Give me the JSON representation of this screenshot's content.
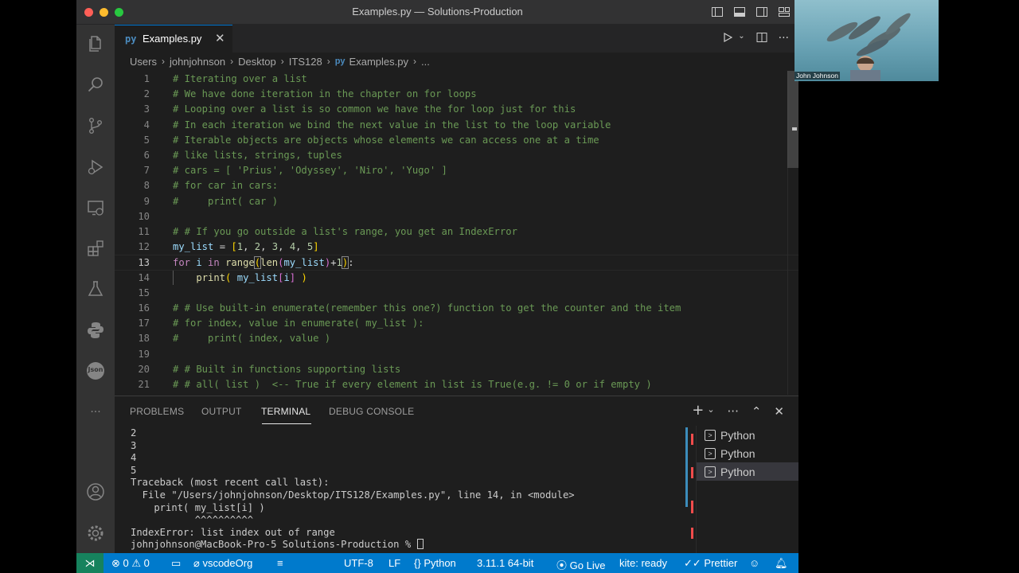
{
  "window": {
    "title": "Examples.py — Solutions-Production"
  },
  "colors": {
    "accent": "#007acc",
    "remote": "#16825d",
    "comment": "#6a9955",
    "keyword": "#c586c0",
    "variable": "#9cdcfe",
    "function": "#dcdcaa",
    "number": "#b5cea8"
  },
  "activity_bar": {
    "items": [
      "files-icon",
      "search-icon",
      "source-control-icon",
      "run-debug-icon",
      "remote-explorer-icon",
      "extensions-icon",
      "testing-icon",
      "python-icon",
      "json-icon",
      "more-icon"
    ],
    "json_label": "Json",
    "bottom": [
      "account-icon",
      "settings-gear-icon"
    ],
    "more": "···"
  },
  "tab": {
    "label": "Examples.py",
    "close": "✕",
    "py_glyph": "py"
  },
  "breadcrumb": [
    "Users",
    "johnjohnson",
    "Desktop",
    "ITS128",
    "Examples.py",
    "..."
  ],
  "editor": {
    "line_numbers": [
      "1",
      "2",
      "3",
      "4",
      "5",
      "6",
      "7",
      "8",
      "9",
      "10",
      "11",
      "12",
      "13",
      "14",
      "15",
      "16",
      "17",
      "18",
      "19",
      "20",
      "21"
    ],
    "comments": {
      "l1": "# Iterating over a list",
      "l2": "# We have done iteration in the chapter on for loops",
      "l3": "# Looping over a list is so common we have the for loop just for this",
      "l4": "# In each iteration we bind the next value in the list to the loop variable",
      "l5": "# Iterable objects are objects whose elements we can access one at a time",
      "l6": "# like lists, strings, tuples",
      "l7": "# cars = [ 'Prius', 'Odyssey', 'Niro', 'Yugo' ]",
      "l8": "# for car in cars:",
      "l9": "#     print( car )",
      "l11": "# # If you go outside a list's range, you get an IndexError",
      "l16": "# # Use built-in enumerate(remember this one?) function to get the counter and the item",
      "l17": "# for index, value in enumerate( my_list ):",
      "l18": "#     print( index, value )",
      "l20": "# # Built in functions supporting lists",
      "l21": "# # all( list )  <-- True if every element in list is True(e.g. != 0 or if empty )"
    },
    "code": {
      "my_list": "my_list",
      "eq": " = ",
      "lb": "[",
      "n1": "1",
      "n2": "2",
      "n3": "3",
      "n4": "4",
      "n5": "5",
      "comma": ", ",
      "rb": "]",
      "for": "for",
      "i": "i",
      "in": "in",
      "range": "range",
      "len": "len",
      "lp": "(",
      "rp": ")",
      "plus": "+",
      "colon": ":",
      "print": "print",
      "sp": " ",
      "sp4": "    "
    }
  },
  "panel": {
    "tabs": [
      "PROBLEMS",
      "OUTPUT",
      "TERMINAL",
      "DEBUG CONSOLE"
    ],
    "active_tab": "TERMINAL",
    "icons": [
      "+",
      "⌄",
      "···",
      "⌃",
      "✕"
    ],
    "terminal_lines": [
      "2",
      "3",
      "4",
      "5",
      "Traceback (most recent call last):",
      "  File \"/Users/johnjohnson/Desktop/ITS128/Examples.py\", line 14, in <module>",
      "    print( my_list[i] )",
      "           ^^^^^^^^^^"
    ],
    "error_line": "IndexError: list index out of range",
    "prompt": "johnjohnson@MacBook-Pro-5 Solutions-Production % ",
    "terminals": [
      "Python",
      "Python",
      "Python"
    ]
  },
  "status_bar": {
    "remote": "⋊",
    "errors": "0",
    "warnings": "0",
    "org": "vscodeOrg",
    "encoding": "UTF-8",
    "eol": "LF",
    "language": "Python",
    "interpreter": "3.11.1 64-bit",
    "golive": "Go Live",
    "kite": "kite: ready",
    "prettier": "Prettier"
  },
  "webcam": {
    "name": "John Johnson"
  }
}
